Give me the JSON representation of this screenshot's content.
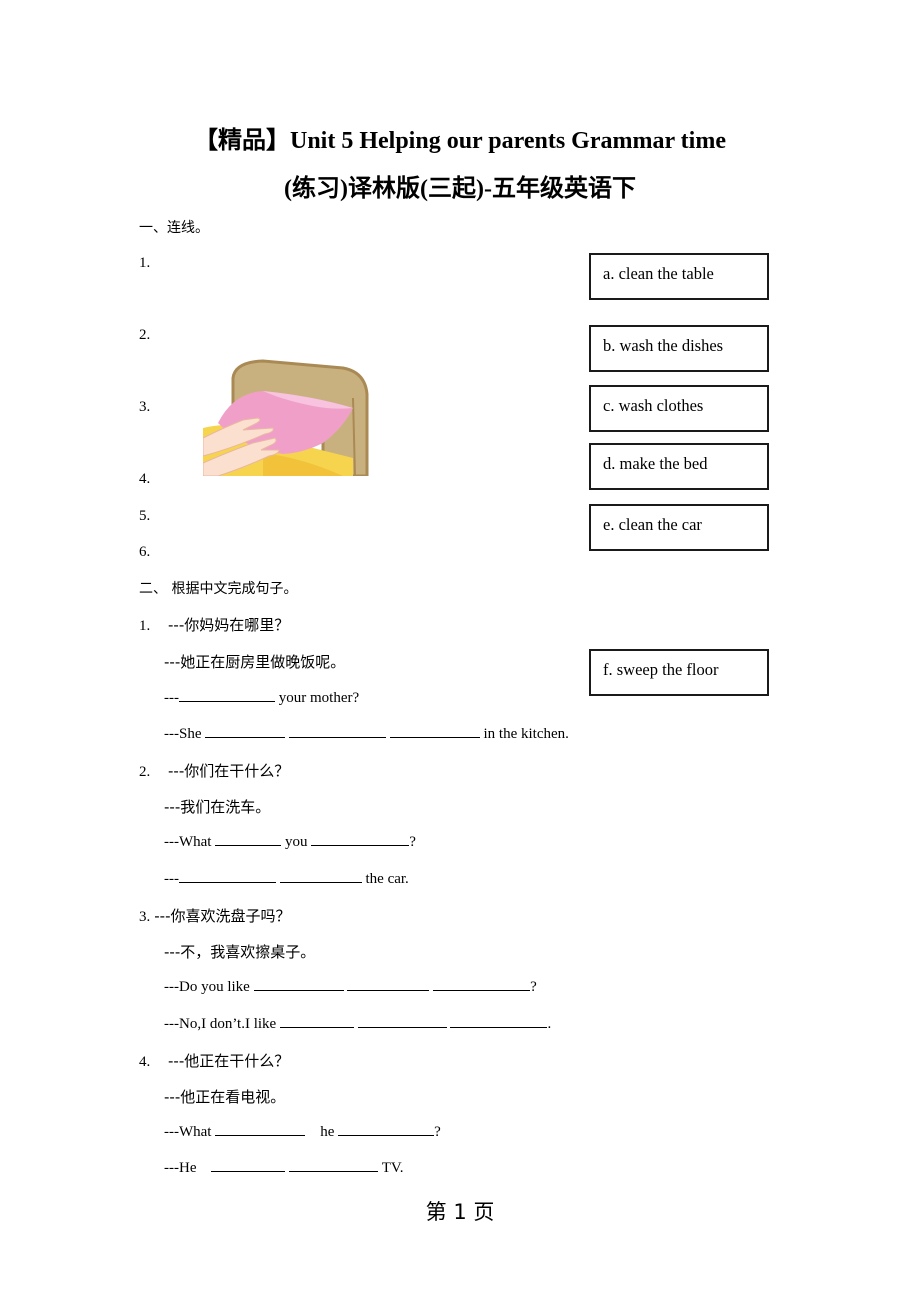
{
  "title": {
    "line1": "【精品】Unit 5 Helping our parents Grammar time",
    "line2": "(练习)译林版(三起)-五年级英语下"
  },
  "section1": {
    "heading": "一、连线。",
    "numbers": [
      "1.",
      "2.",
      "3.",
      "4.",
      "5.",
      "6."
    ],
    "picture": {
      "icon": "make-the-bed-illustration",
      "description": "hands smoothing a pink pillow on a bed"
    },
    "options": [
      "a. clean the table",
      "b. wash the dishes",
      "c. wash clothes",
      "d. make the bed",
      "e. clean the car",
      "f. sweep the floor"
    ]
  },
  "section2": {
    "heading": "二、 根据中文完成句子。",
    "questions": [
      {
        "num": "1.",
        "q_cn": "---你妈妈在哪里？",
        "a_cn": "---她正在厨房里做晚饭呢。",
        "q_en": {
          "prefix": "---",
          "after1": " your mother?"
        },
        "a_en": {
          "prefix": "---She ",
          "suffix": " in the kitchen."
        }
      },
      {
        "num": "2.",
        "q_cn": "---你们在干什么？",
        "a_cn": "---我们在洗车。",
        "q_en": {
          "prefix": "---What ",
          "mid": " you ",
          "suffix": "?"
        },
        "a_en": {
          "prefix": "---",
          "suffix": " the car."
        }
      },
      {
        "num": "3.",
        "q_cn": "---你喜欢洗盘子吗？",
        "a_cn": "---不，我喜欢擦桌子。",
        "q_en": {
          "prefix": "---Do you like ",
          "suffix": "?"
        },
        "a_en": {
          "prefix": "---No,I don’t.I like ",
          "suffix": "."
        }
      },
      {
        "num": "4.",
        "q_cn": "---他正在干什么？",
        "a_cn": "---他正在看电视。",
        "q_en": {
          "prefix": "---What ",
          "mid": "    he ",
          "suffix": "?"
        },
        "a_en": {
          "prefix": "---He    ",
          "suffix": " TV."
        }
      }
    ]
  },
  "footer": {
    "page_label": "第 1 页"
  }
}
